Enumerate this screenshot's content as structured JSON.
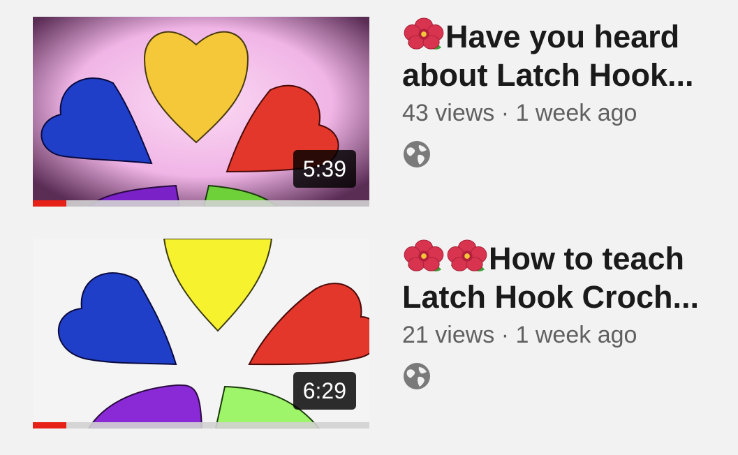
{
  "videos": [
    {
      "title_line1": "Have you heard",
      "title_line2": "about Latch Hook...",
      "emoji_count": 1,
      "emoji": "hibiscus-icon",
      "views": "43 views",
      "separator": "·",
      "age": "1 week ago",
      "duration": "5:39",
      "watched_progress": 0.1,
      "visibility_icon": "globe-icon"
    },
    {
      "title_line1": "How to teach",
      "title_line2": "Latch Hook Croch...",
      "emoji_count": 2,
      "emoji": "hibiscus-icon",
      "views": "21 views",
      "separator": "·",
      "age": "1 week ago",
      "duration": "6:29",
      "watched_progress": 0.1,
      "visibility_icon": "globe-icon"
    }
  ],
  "colors": {
    "progress": "#e62117",
    "heart_yellow": "#f5c83a",
    "heart_blue": "#1f3fc8",
    "heart_red": "#e2372a",
    "heart_purple": "#7a22c8",
    "heart_green": "#6fd13a"
  }
}
